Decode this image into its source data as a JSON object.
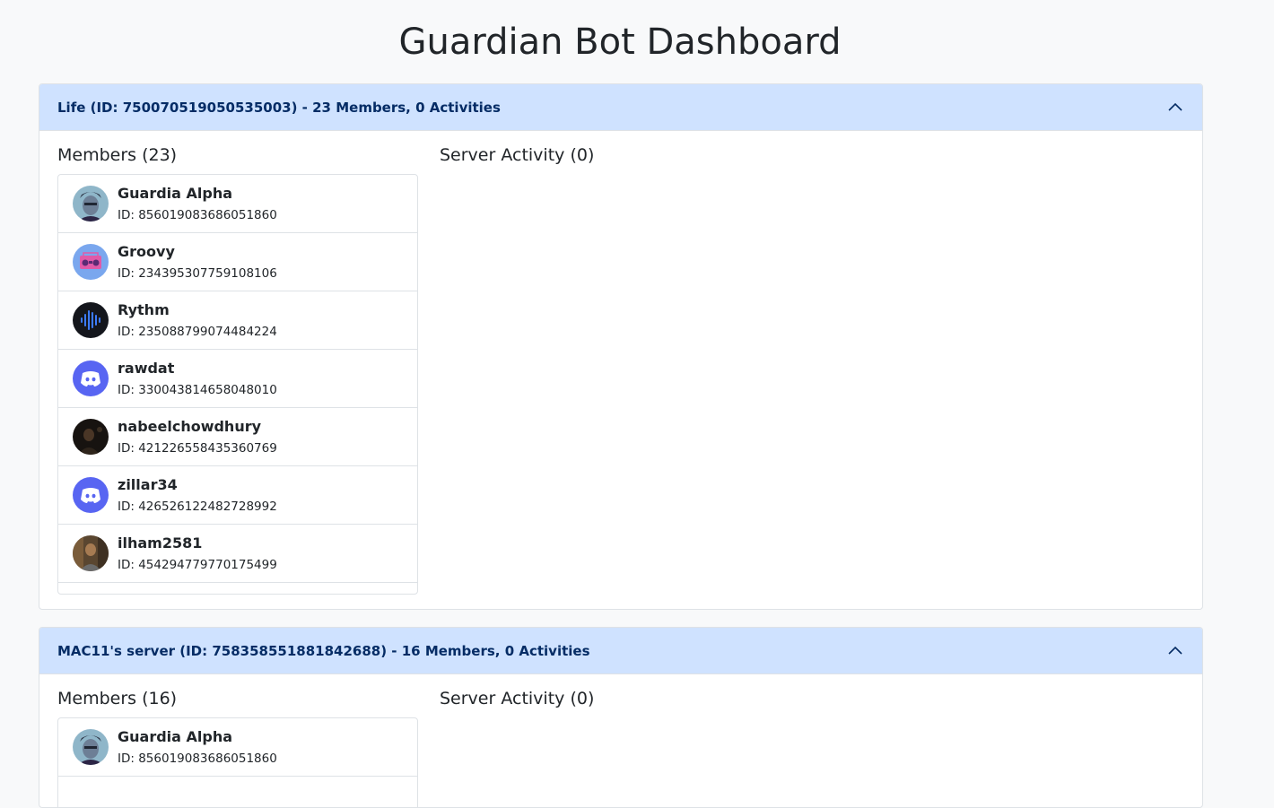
{
  "page": {
    "title": "Guardian Bot Dashboard"
  },
  "servers": [
    {
      "header": "Life (ID: 750070519050535003) - 23 Members, 0 Activities",
      "members_title": "Members (23)",
      "activity_title": "Server Activity (0)",
      "members": [
        {
          "name": "Guardia Alpha",
          "id": "ID: 856019083686051860",
          "avatar": "anime-character-avatar"
        },
        {
          "name": "Groovy",
          "id": "ID: 234395307759108106",
          "avatar": "boombox-avatar"
        },
        {
          "name": "Rythm",
          "id": "ID: 235088799074484224",
          "avatar": "soundwave-avatar"
        },
        {
          "name": "rawdat",
          "id": "ID: 330043814658048010",
          "avatar": "discord-default-avatar"
        },
        {
          "name": "nabeelchowdhury",
          "id": "ID: 421226558435360769",
          "avatar": "photo-avatar"
        },
        {
          "name": "zillar34",
          "id": "ID: 426526122482728992",
          "avatar": "discord-default-avatar"
        },
        {
          "name": "ilham2581",
          "id": "ID: 454294779770175499",
          "avatar": "photo-avatar"
        }
      ]
    },
    {
      "header": "MAC11's server (ID: 758358551881842688) - 16 Members, 0 Activities",
      "members_title": "Members (16)",
      "activity_title": "Server Activity (0)",
      "members": [
        {
          "name": "Guardia Alpha",
          "id": "ID: 856019083686051860",
          "avatar": "anime-character-avatar"
        }
      ]
    }
  ],
  "colors": {
    "header_bg": "#cfe2ff",
    "header_text": "#052c65",
    "discord_blurple": "#5865f2",
    "page_bg": "#f8f9fa"
  }
}
